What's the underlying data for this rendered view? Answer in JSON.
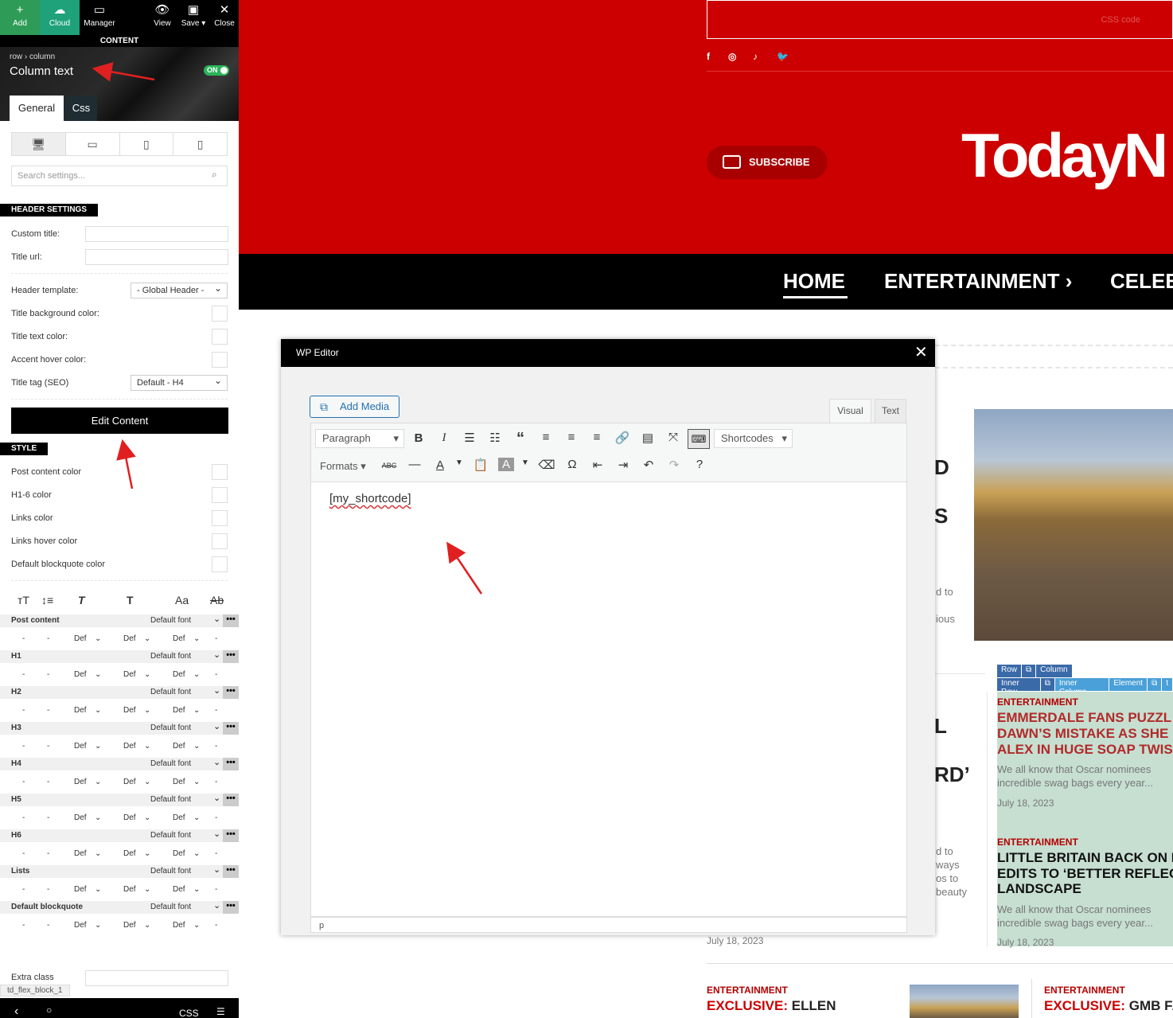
{
  "panel": {
    "toolbar": {
      "add": "Add",
      "cloud": "Cloud",
      "manager": "Manager",
      "view": "View",
      "save": "Save ▾",
      "close": "Close"
    },
    "content_bar": "CONTENT",
    "breadcrumb": "row  ›  column",
    "title": "Column text",
    "toggle": "ON",
    "tabs": [
      "General",
      "Css"
    ],
    "search_placeholder": "Search settings...",
    "header_settings": {
      "heading": "HEADER SETTINGS",
      "custom_title": "Custom title:",
      "title_url": "Title url:",
      "header_template": "Header template:",
      "header_template_value": "- Global Header -",
      "title_bg": "Title background color:",
      "title_text": "Title text color:",
      "accent_hover": "Accent hover color:",
      "title_tag": "Title tag (SEO)",
      "title_tag_value": "Default - H4"
    },
    "edit_content": "Edit Content",
    "style": {
      "heading": "STYLE",
      "post_content_color": "Post content color",
      "h16_color": "H1-6 color",
      "links_color": "Links color",
      "links_hover": "Links hover color",
      "blockquote_color": "Default blockquote color"
    },
    "font_icons": [
      "ᴛT",
      "↕≡",
      "T",
      "T",
      "Aa",
      "Ab"
    ],
    "font_rows": [
      {
        "name": "Post content",
        "font": "Default font"
      },
      {
        "name": "H1",
        "font": "Default font"
      },
      {
        "name": "H2",
        "font": "Default font"
      },
      {
        "name": "H3",
        "font": "Default font"
      },
      {
        "name": "H4",
        "font": "Default font"
      },
      {
        "name": "H5",
        "font": "Default font"
      },
      {
        "name": "H6",
        "font": "Default font"
      },
      {
        "name": "Lists",
        "font": "Default font"
      },
      {
        "name": "Default blockquote",
        "font": "Default font"
      }
    ],
    "font_sub": {
      "dash": "-",
      "def": "Def"
    },
    "extra_class": "Extra class",
    "block_tag": "td_flex_block_1",
    "bottom": {
      "back": "‹",
      "search": "○",
      "css": "CSS",
      "menu": "☰"
    }
  },
  "site": {
    "css_code": "CSS code",
    "social": [
      "f",
      "◎",
      "♪",
      "🐦"
    ],
    "subscribe": "SUBSCRIBE",
    "logo": "TodayN",
    "nav": [
      "HOME",
      "ENTERTAINMENT  ›",
      "CELEE"
    ],
    "partial_text": [
      "D",
      "S",
      "d to",
      "ious",
      "L",
      "RD’",
      "d to",
      "ways",
      "os to",
      "beauty"
    ],
    "row_tags": [
      "Row",
      "⧉",
      "Column"
    ],
    "inner_tags": [
      "Inner Row",
      "⧉",
      "Inner Column",
      "Element",
      "⧉",
      "t"
    ],
    "articles": [
      {
        "category": "ENTERTAINMENT",
        "title_lines": [
          "EMMERDALE FANS PUZZL",
          "DAWN’S MISTAKE AS SHE",
          "ALEX IN HUGE SOAP TWIS"
        ],
        "excerpt_lines": [
          "We all know that Oscar nominees",
          "incredible swag bags every year..."
        ],
        "date": "July 18, 2023"
      },
      {
        "category": "ENTERTAINMENT",
        "title_lines": [
          "LITTLE BRITAIN BACK ON I",
          "EDITS TO ‘BETTER REFLEC",
          "LANDSCAPE"
        ],
        "excerpt_lines": [
          "We all know that Oscar nominees",
          "incredible swag bags every year..."
        ],
        "date": "July 18, 2023"
      }
    ],
    "left_date": "July 18, 2023",
    "bottom_articles": [
      {
        "category": "ENTERTAINMENT",
        "prefix": "EXCLUSIVE:",
        "rest": "ELLEN"
      },
      {
        "category": "ENTERTAINMENT",
        "prefix": "EXCLUSIVE:",
        "rest": "GMB FA"
      }
    ]
  },
  "modal": {
    "title": "WP Editor",
    "close": "✕",
    "add_media": "Add Media",
    "tabs": [
      "Visual",
      "Text"
    ],
    "paragraph": "Paragraph",
    "shortcodes": "Shortcodes",
    "formats": "Formats",
    "content": "[my_shortcode]",
    "path": "p"
  },
  "colors": {
    "red": "#cc0000",
    "black": "#000000",
    "green": "#2e9c57",
    "wp_blue": "#2271b1"
  }
}
